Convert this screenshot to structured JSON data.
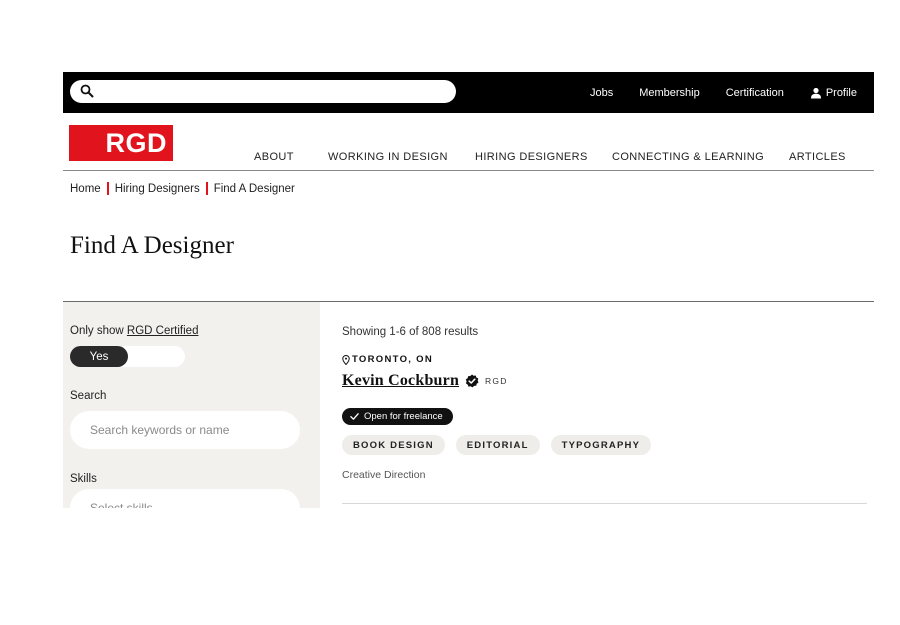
{
  "topbar": {
    "search_value": "",
    "links": [
      "Jobs",
      "Membership",
      "Certification",
      "Profile"
    ]
  },
  "header": {
    "logo_text": "RGD",
    "nav": [
      "ABOUT",
      "WORKING IN DESIGN",
      "HIRING DESIGNERS",
      "CONNECTING & LEARNING",
      "ARTICLES"
    ]
  },
  "breadcrumb": [
    "Home",
    "Hiring Designers",
    "Find A Designer"
  ],
  "page_title": "Find A Designer",
  "sidebar": {
    "certified_prefix": "Only show ",
    "certified_link": "RGD Certified",
    "toggle_label": "Yes",
    "search_label": "Search",
    "search_placeholder": "Search keywords or name",
    "skills_label": "Skills",
    "skills_placeholder": "Select skills"
  },
  "results": {
    "count_text": "Showing 1-6 of 808 results",
    "items": [
      {
        "location": "TORONTO, ON",
        "name": "Kevin Cockburn",
        "cert": "RGD",
        "freelance": "Open for freelance",
        "tags": [
          "BOOK DESIGN",
          "EDITORIAL",
          "TYPOGRAPHY"
        ],
        "role": "Creative Direction"
      }
    ]
  },
  "colors": {
    "brand_red": "#e1141d",
    "topbar": "#000000",
    "sidebar_bg": "#f2f1ee"
  }
}
